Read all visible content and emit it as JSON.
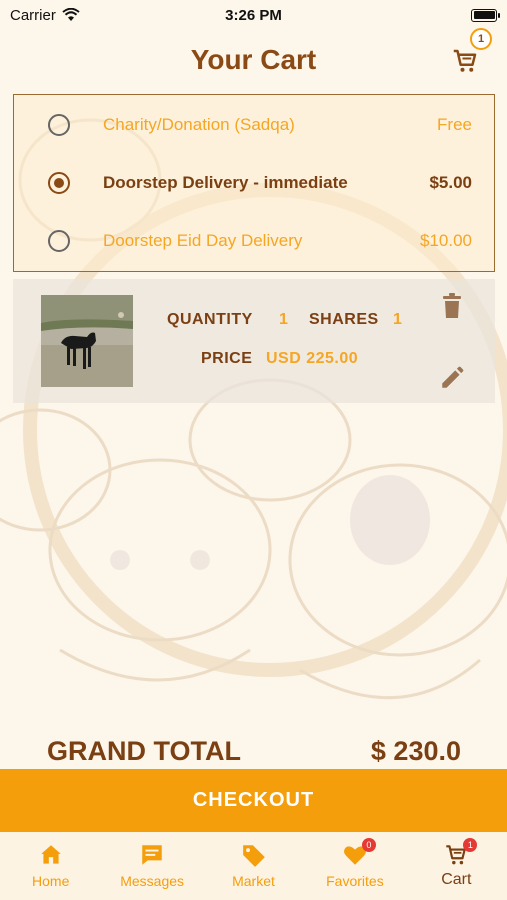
{
  "status_bar": {
    "carrier": "Carrier",
    "time": "3:26 PM"
  },
  "header": {
    "title": "Your Cart",
    "cart_badge": "1"
  },
  "delivery_options": [
    {
      "label": "Charity/Donation (Sadqa)",
      "price": "Free",
      "selected": false
    },
    {
      "label": "Doorstep Delivery - immediate",
      "price": "$5.00",
      "selected": true
    },
    {
      "label": "Doorstep Eid Day Delivery",
      "price": "$10.00",
      "selected": false
    }
  ],
  "cart_item": {
    "quantity_label": "QUANTITY",
    "quantity_value": "1",
    "shares_label": "SHARES",
    "shares_value": "1",
    "price_label": "PRICE",
    "price_value": "USD 225.00"
  },
  "grand_total": {
    "label": "GRAND TOTAL",
    "value": "$ 230.0"
  },
  "checkout": {
    "label": "CHECKOUT"
  },
  "tab_bar": {
    "items": [
      {
        "label": "Home",
        "icon": "home-icon",
        "badge": ""
      },
      {
        "label": "Messages",
        "icon": "chat-icon",
        "badge": ""
      },
      {
        "label": "Market",
        "icon": "tag-icon",
        "badge": ""
      },
      {
        "label": "Favorites",
        "icon": "heart-icon",
        "badge": "0"
      },
      {
        "label": "Cart",
        "icon": "cart-icon",
        "badge": "1"
      }
    ]
  },
  "colors": {
    "accent": "#f59e0b",
    "brown": "#7a3f12",
    "background": "#fdf6ea"
  }
}
